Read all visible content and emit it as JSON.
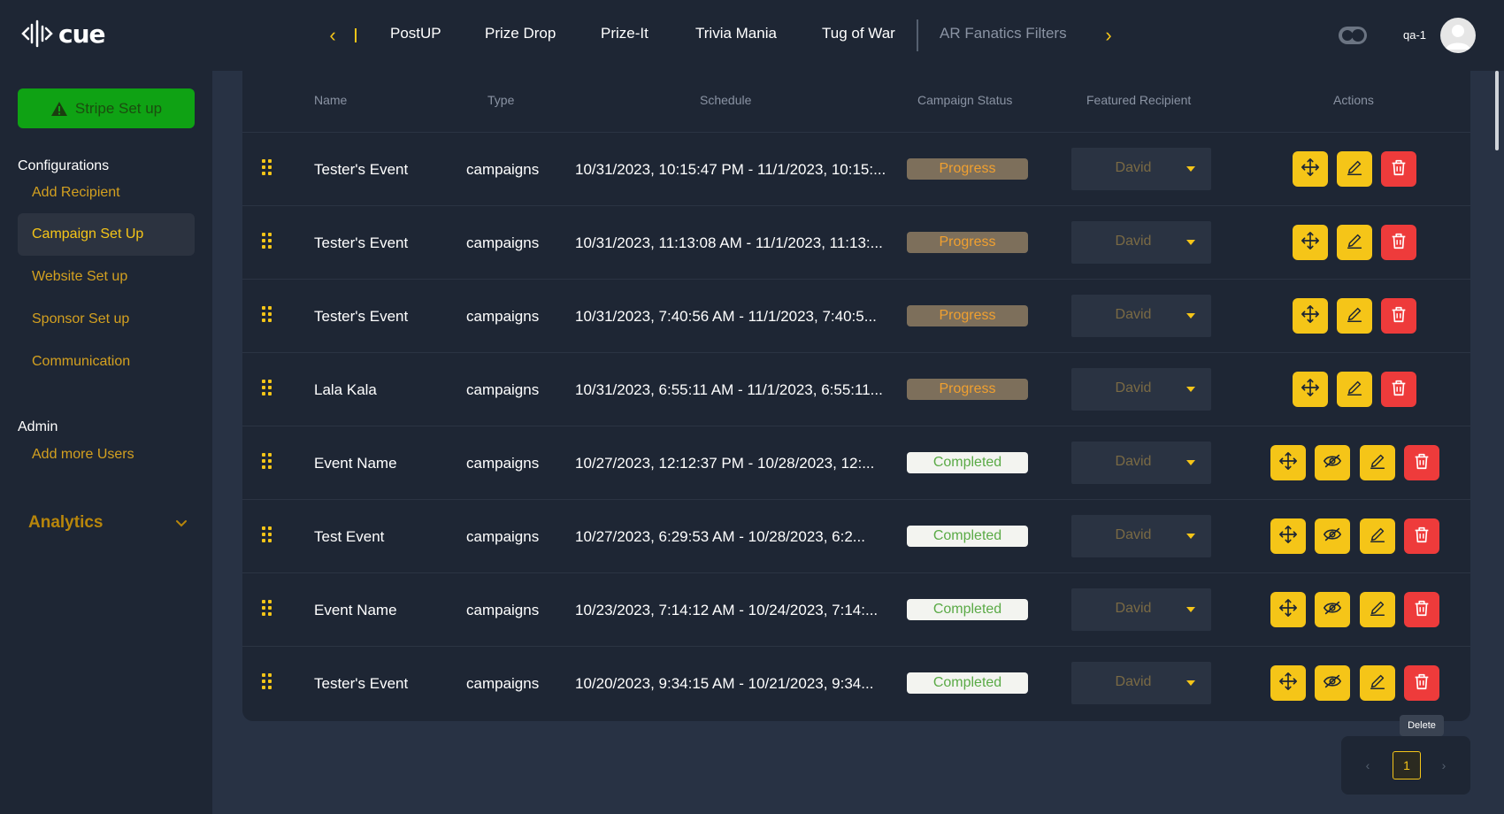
{
  "app": {
    "logo_text": "cue"
  },
  "topnav": {
    "tabs": [
      "PostUP",
      "Prize Drop",
      "Prize-It",
      "Trivia Mania",
      "Tug of War",
      "AR Fanatics Filters"
    ],
    "prev_label": "‹",
    "next_label": "›"
  },
  "user": {
    "name": "qa-1"
  },
  "sidebar": {
    "stripe_button": "Stripe Set up",
    "configurations_title": "Configurations",
    "config_items": [
      "Add Recipient",
      "Campaign Set Up",
      "Website Set up",
      "Sponsor Set up",
      "Communication"
    ],
    "active_item": "Campaign Set Up",
    "admin_title": "Admin",
    "admin_items": [
      "Add more Users"
    ],
    "analytics_label": "Analytics"
  },
  "table": {
    "headers": {
      "name": "Name",
      "type": "Type",
      "schedule": "Schedule",
      "status": "Campaign Status",
      "recipient": "Featured Recipient",
      "actions": "Actions"
    },
    "rows": [
      {
        "name": "Tester's Event",
        "type": "campaigns",
        "schedule": "10/31/2023, 10:15:47 PM - 11/1/2023, 10:15:...",
        "status": "Progress",
        "recipient": "David"
      },
      {
        "name": "Tester's Event",
        "type": "campaigns",
        "schedule": "10/31/2023, 11:13:08 AM - 11/1/2023, 11:13:...",
        "status": "Progress",
        "recipient": "David"
      },
      {
        "name": "Tester's Event",
        "type": "campaigns",
        "schedule": "10/31/2023, 7:40:56 AM - 11/1/2023, 7:40:5...",
        "status": "Progress",
        "recipient": "David"
      },
      {
        "name": "Lala Kala",
        "type": "campaigns",
        "schedule": "10/31/2023, 6:55:11 AM - 11/1/2023, 6:55:11...",
        "status": "Progress",
        "recipient": "David"
      },
      {
        "name": "Event Name",
        "type": "campaigns",
        "schedule": "10/27/2023, 12:12:37 PM - 10/28/2023, 12:...",
        "status": "Completed",
        "recipient": "David"
      },
      {
        "name": "Test Event",
        "type": "campaigns",
        "schedule": "10/27/2023, 6:29:53 AM - 10/28/2023, 6:2...",
        "status": "Completed",
        "recipient": "David"
      },
      {
        "name": "Event Name",
        "type": "campaigns",
        "schedule": "10/23/2023, 7:14:12 AM - 10/24/2023, 7:14:...",
        "status": "Completed",
        "recipient": "David"
      },
      {
        "name": "Tester's Event",
        "type": "campaigns",
        "schedule": "10/20/2023, 9:34:15 AM - 10/21/2023, 9:34...",
        "status": "Completed",
        "recipient": "David"
      }
    ]
  },
  "tooltip": {
    "text": "Delete"
  },
  "pagination": {
    "current_page": "1",
    "prev_label": "‹",
    "next_label": "›"
  },
  "colors": {
    "background": "#283244",
    "panel": "#1e2634",
    "accent": "#f5c518",
    "danger": "#ee3b3b",
    "stripe_green": "#0fa214",
    "progress_bg": "#7d6f5b",
    "completed_bg": "#f3f4f0"
  },
  "icons": [
    "drag-handle-icon",
    "move-icon",
    "hide-icon",
    "edit-icon",
    "delete-icon",
    "warning-icon",
    "chevron-down-icon",
    "caret-down-icon"
  ]
}
